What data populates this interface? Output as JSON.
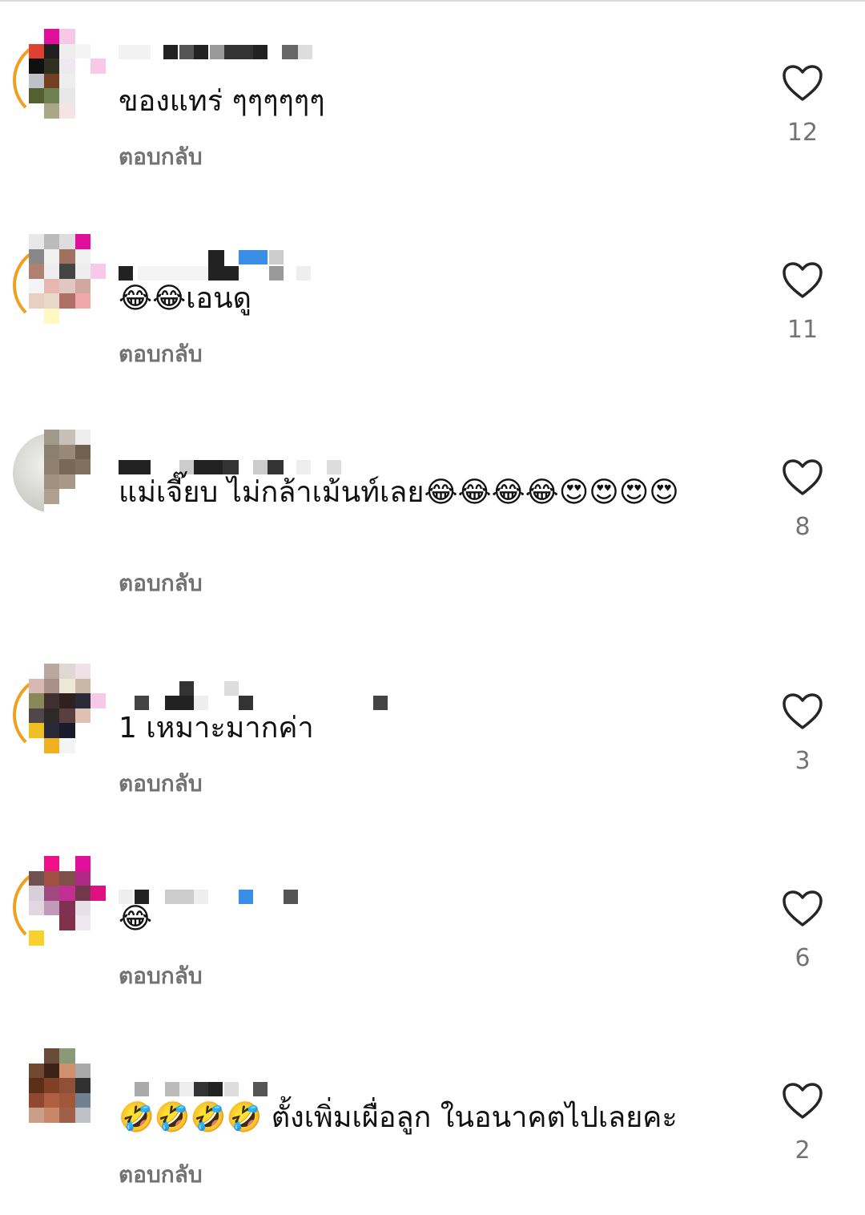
{
  "reply_label": "ตอบกลับ",
  "icons": {
    "like": "heart-outline-icon"
  },
  "colors": {
    "text": "#111111",
    "secondary": "#737373",
    "divider": "#d9d9d9"
  },
  "comments": [
    {
      "text": "ของแทร่ ๆๆๆๆๆๆ",
      "likes": "12"
    },
    {
      "text": "😂😂เอนดู",
      "likes": "11"
    },
    {
      "text": "แม่เจี๊ยบ ไม่กล้าเม้นท์เลย😂😂😂😂😍😍😍😍",
      "likes": "8"
    },
    {
      "text": "1 เหมาะมากค่า",
      "likes": "3"
    },
    {
      "text": "😂",
      "likes": "6"
    },
    {
      "text": "🤣🤣🤣🤣 ตั้งเพิ่มเผื่อลูก ในอนาคตไปเลยคะ",
      "likes": "2"
    }
  ]
}
